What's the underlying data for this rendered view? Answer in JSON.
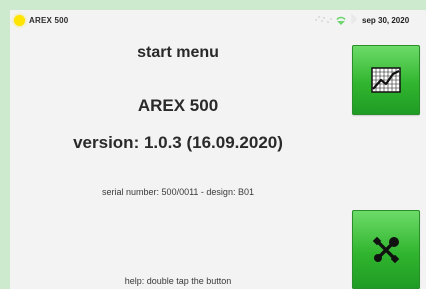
{
  "statusbar": {
    "device_name": "AREX 500",
    "date": "sep 30, 2020",
    "icons": [
      "signal-icon",
      "wifi-icon",
      "bluetooth-icon"
    ]
  },
  "main": {
    "title": "start menu",
    "model": "AREX 500",
    "version": "version: 1.0.3 (16.09.2020)",
    "serial": "serial number: 500/0011 - design: B01",
    "help": "help: double tap the button"
  },
  "buttons": {
    "chart": {
      "icon": "line-chart-icon"
    },
    "tools": {
      "icon": "tools-icon"
    }
  },
  "colors": {
    "led": "#ffe400",
    "button_green": "#31b52f",
    "screen_bg": "#f3f3f3",
    "frame_bg": "#cdeacf"
  }
}
